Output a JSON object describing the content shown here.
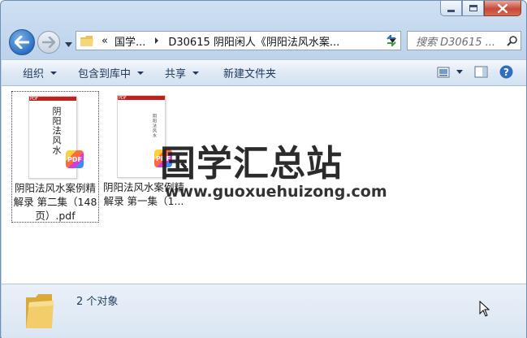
{
  "window": {
    "accent_color": "#c4d8ee",
    "close_color": "#c7483a"
  },
  "caption_buttons": {
    "minimize_icon": "minimize-icon",
    "maximize_icon": "maximize-icon",
    "close_icon": "close-icon"
  },
  "nav": {
    "back_icon": "back-arrow-icon",
    "forward_icon": "forward-arrow-icon",
    "history_icon": "chevron-down-icon"
  },
  "address": {
    "overflow": "«",
    "crumbs": [
      "国学...",
      "D30615 阴阳闲人《阴阳法风水案..."
    ]
  },
  "search": {
    "placeholder": "搜索 D30615 ..."
  },
  "toolbar": {
    "organize": "组织",
    "include_library": "包含到库中",
    "share": "共享",
    "new_folder": "新建文件夹"
  },
  "files": [
    {
      "name": "阴阳法风水案例精解录 第二集（148页）.pdf",
      "thumb_title": "阴阳法风水",
      "badge": "PDF",
      "selected": true
    },
    {
      "name": "阴阳法风水案例精解录 第一集（1...",
      "thumb_title": "阴阳法风水",
      "badge": "PDF",
      "selected": false
    }
  ],
  "thumb_header": "PDF",
  "watermark": {
    "title": "国学汇总站",
    "url": "www.guoxuehuizong.com"
  },
  "status": {
    "count_text": "2 个对象"
  }
}
